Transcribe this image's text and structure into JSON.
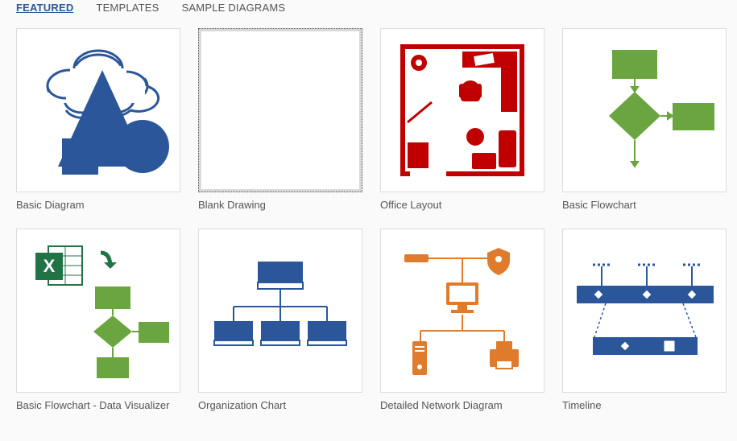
{
  "tabs": {
    "featured": "FEATURED",
    "templates": "TEMPLATES",
    "sample": "SAMPLE DIAGRAMS"
  },
  "templates": {
    "basic_diagram": "Basic Diagram",
    "blank_drawing": "Blank Drawing",
    "office_layout": "Office Layout",
    "basic_flowchart": "Basic Flowchart",
    "flowchart_dv": "Basic Flowchart - Data Visualizer",
    "org_chart": "Organization Chart",
    "network": "Detailed Network Diagram",
    "timeline": "Timeline"
  },
  "colors": {
    "blue": "#2b579a",
    "green": "#6ba53f",
    "red": "#c00000",
    "orange": "#e07b2c",
    "excel": "#217346"
  }
}
